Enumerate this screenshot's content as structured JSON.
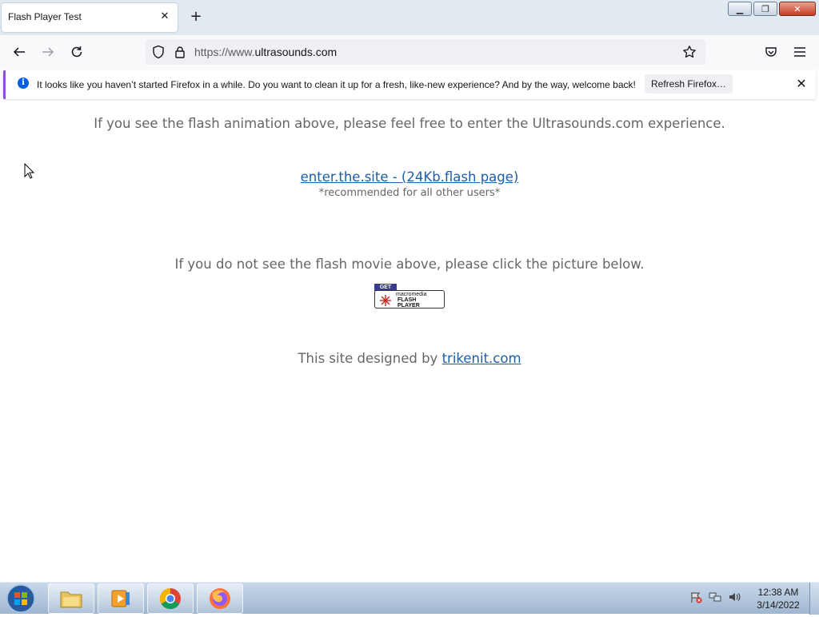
{
  "browser": {
    "tab_title": "Flash Player Test",
    "url_prefix": "https://www.",
    "url_domain": "ultrasounds.com",
    "notification": {
      "text": "It looks like you haven’t started Firefox in a while. Do you want to clean it up for a fresh, like-new experience? And by the way, welcome back!",
      "button": "Refresh Firefox…"
    }
  },
  "page": {
    "intro": "If you see the flash animation above, please feel free to enter the Ultrasounds.com experience.",
    "enter_link": "enter.the.site - (24Kb.flash page)",
    "recommended": "*recommended for all other users*",
    "no_flash": "If you do not see the flash movie above, please click the picture below.",
    "badge": {
      "get": "GET",
      "brand": "macromedia",
      "line1": "FLASH",
      "line2": "PLAYER"
    },
    "credit_prefix": "This site designed by ",
    "credit_link": "trikenit.com"
  },
  "taskbar": {
    "time": "12:38 AM",
    "date": "3/14/2022",
    "apps": [
      "file-explorer",
      "media-player",
      "chrome",
      "firefox"
    ]
  },
  "colors": {
    "link": "#1a5fa8",
    "text": "#666666",
    "notif_accent": "#8f4ed8"
  }
}
